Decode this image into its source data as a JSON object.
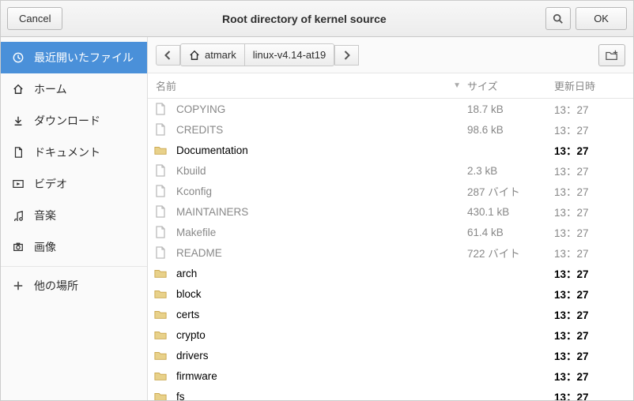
{
  "titlebar": {
    "cancel": "Cancel",
    "title": "Root directory of kernel source",
    "ok": "OK"
  },
  "sidebar": {
    "items": [
      {
        "icon": "recent",
        "label": "最近開いたファイル",
        "active": true
      },
      {
        "icon": "home",
        "label": "ホーム"
      },
      {
        "icon": "download",
        "label": "ダウンロード"
      },
      {
        "icon": "document",
        "label": "ドキュメント"
      },
      {
        "icon": "video",
        "label": "ビデオ"
      },
      {
        "icon": "music",
        "label": "音楽"
      },
      {
        "icon": "picture",
        "label": "画像"
      }
    ],
    "other": {
      "icon": "plus",
      "label": "他の場所"
    }
  },
  "path": {
    "segments": [
      {
        "icon": "home",
        "label": "atmark"
      },
      {
        "label": "linux-v4.14-at19"
      }
    ]
  },
  "columns": {
    "name": "名前",
    "size": "サイズ",
    "date": "更新日時"
  },
  "files": [
    {
      "type": "file",
      "name": "COPYING",
      "size": "18.7 kB",
      "date": "13：27"
    },
    {
      "type": "file",
      "name": "CREDITS",
      "size": "98.6 kB",
      "date": "13：27"
    },
    {
      "type": "folder",
      "name": "Documentation",
      "size": "",
      "date": "13：27"
    },
    {
      "type": "file",
      "name": "Kbuild",
      "size": "2.3 kB",
      "date": "13：27"
    },
    {
      "type": "file",
      "name": "Kconfig",
      "size": "287 バイト",
      "date": "13：27"
    },
    {
      "type": "file",
      "name": "MAINTAINERS",
      "size": "430.1 kB",
      "date": "13：27"
    },
    {
      "type": "file",
      "name": "Makefile",
      "size": "61.4 kB",
      "date": "13：27"
    },
    {
      "type": "file",
      "name": "README",
      "size": "722 バイト",
      "date": "13：27"
    },
    {
      "type": "folder",
      "name": "arch",
      "size": "",
      "date": "13：27"
    },
    {
      "type": "folder",
      "name": "block",
      "size": "",
      "date": "13：27"
    },
    {
      "type": "folder",
      "name": "certs",
      "size": "",
      "date": "13：27"
    },
    {
      "type": "folder",
      "name": "crypto",
      "size": "",
      "date": "13：27"
    },
    {
      "type": "folder",
      "name": "drivers",
      "size": "",
      "date": "13：27"
    },
    {
      "type": "folder",
      "name": "firmware",
      "size": "",
      "date": "13：27"
    },
    {
      "type": "folder",
      "name": "fs",
      "size": "",
      "date": "13：27"
    }
  ]
}
